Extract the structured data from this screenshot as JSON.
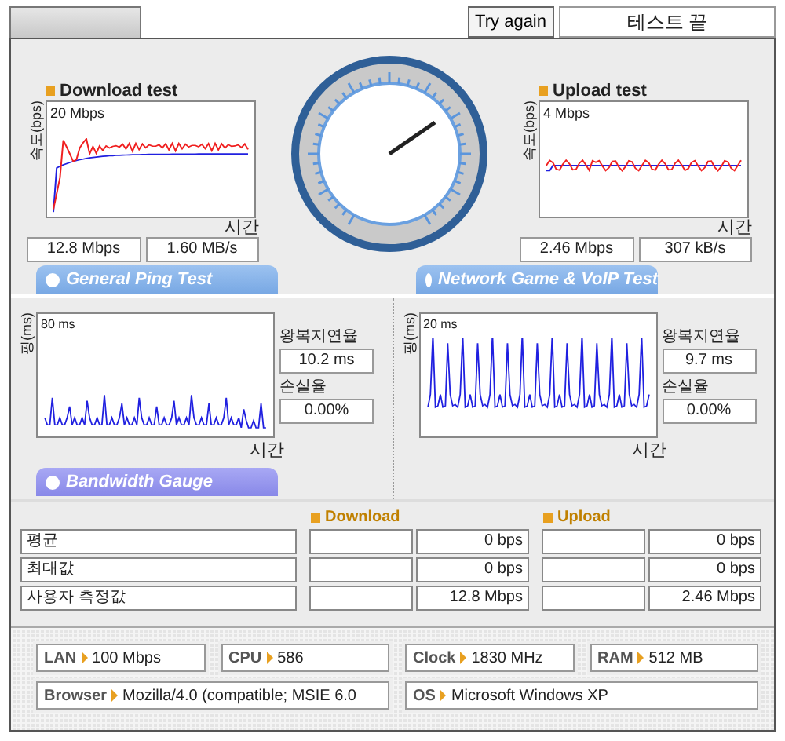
{
  "header": {
    "try_again": "Try again",
    "status": "테스트 끝"
  },
  "speed_tests": [
    {
      "title": "Download test",
      "y_label": "속도(bps)",
      "max_label": "20 Mbps",
      "x_label": "시간",
      "readings": [
        "12.8 Mbps",
        "1.60 MB/s"
      ]
    },
    {
      "title": "Upload test",
      "y_label": "속도(bps)",
      "max_label": "4 Mbps",
      "x_label": "시간",
      "readings": [
        "2.46 Mbps",
        "307 kB/s"
      ]
    }
  ],
  "ping_tests": [
    {
      "tab": "General Ping Test",
      "y_label": "핑(ms)",
      "max_label": "80 ms",
      "x_label": "시간",
      "latency_label": "왕복지연율",
      "latency": "10.2 ms",
      "loss_label": "손실율",
      "loss": "0.00%"
    },
    {
      "tab": "Network Game & VoIP Test",
      "y_label": "핑(ms)",
      "max_label": "20 ms",
      "x_label": "시간",
      "latency_label": "왕복지연율",
      "latency": "9.7 ms",
      "loss_label": "손실율",
      "loss": "0.00%"
    }
  ],
  "bandwidth": {
    "tab": "Bandwidth Gauge",
    "columns": [
      "Download",
      "Upload"
    ],
    "rows": [
      {
        "label": "평균",
        "download": "0 bps",
        "upload": "0 bps"
      },
      {
        "label": "최대값",
        "download": "0 bps",
        "upload": "0 bps"
      },
      {
        "label": "사용자 측정값",
        "download": "12.8 Mbps",
        "upload": "2.46 Mbps"
      }
    ]
  },
  "system_info": [
    {
      "label": "LAN",
      "value": "100 Mbps"
    },
    {
      "label": "CPU",
      "value": "586"
    },
    {
      "label": "Clock",
      "value": "1830 MHz"
    },
    {
      "label": "RAM",
      "value": "512 MB"
    },
    {
      "label": "Browser",
      "value": "Mozilla/4.0 (compatible; MSIE 6.0"
    },
    {
      "label": "OS",
      "value": "Microsoft Windows XP"
    }
  ]
}
